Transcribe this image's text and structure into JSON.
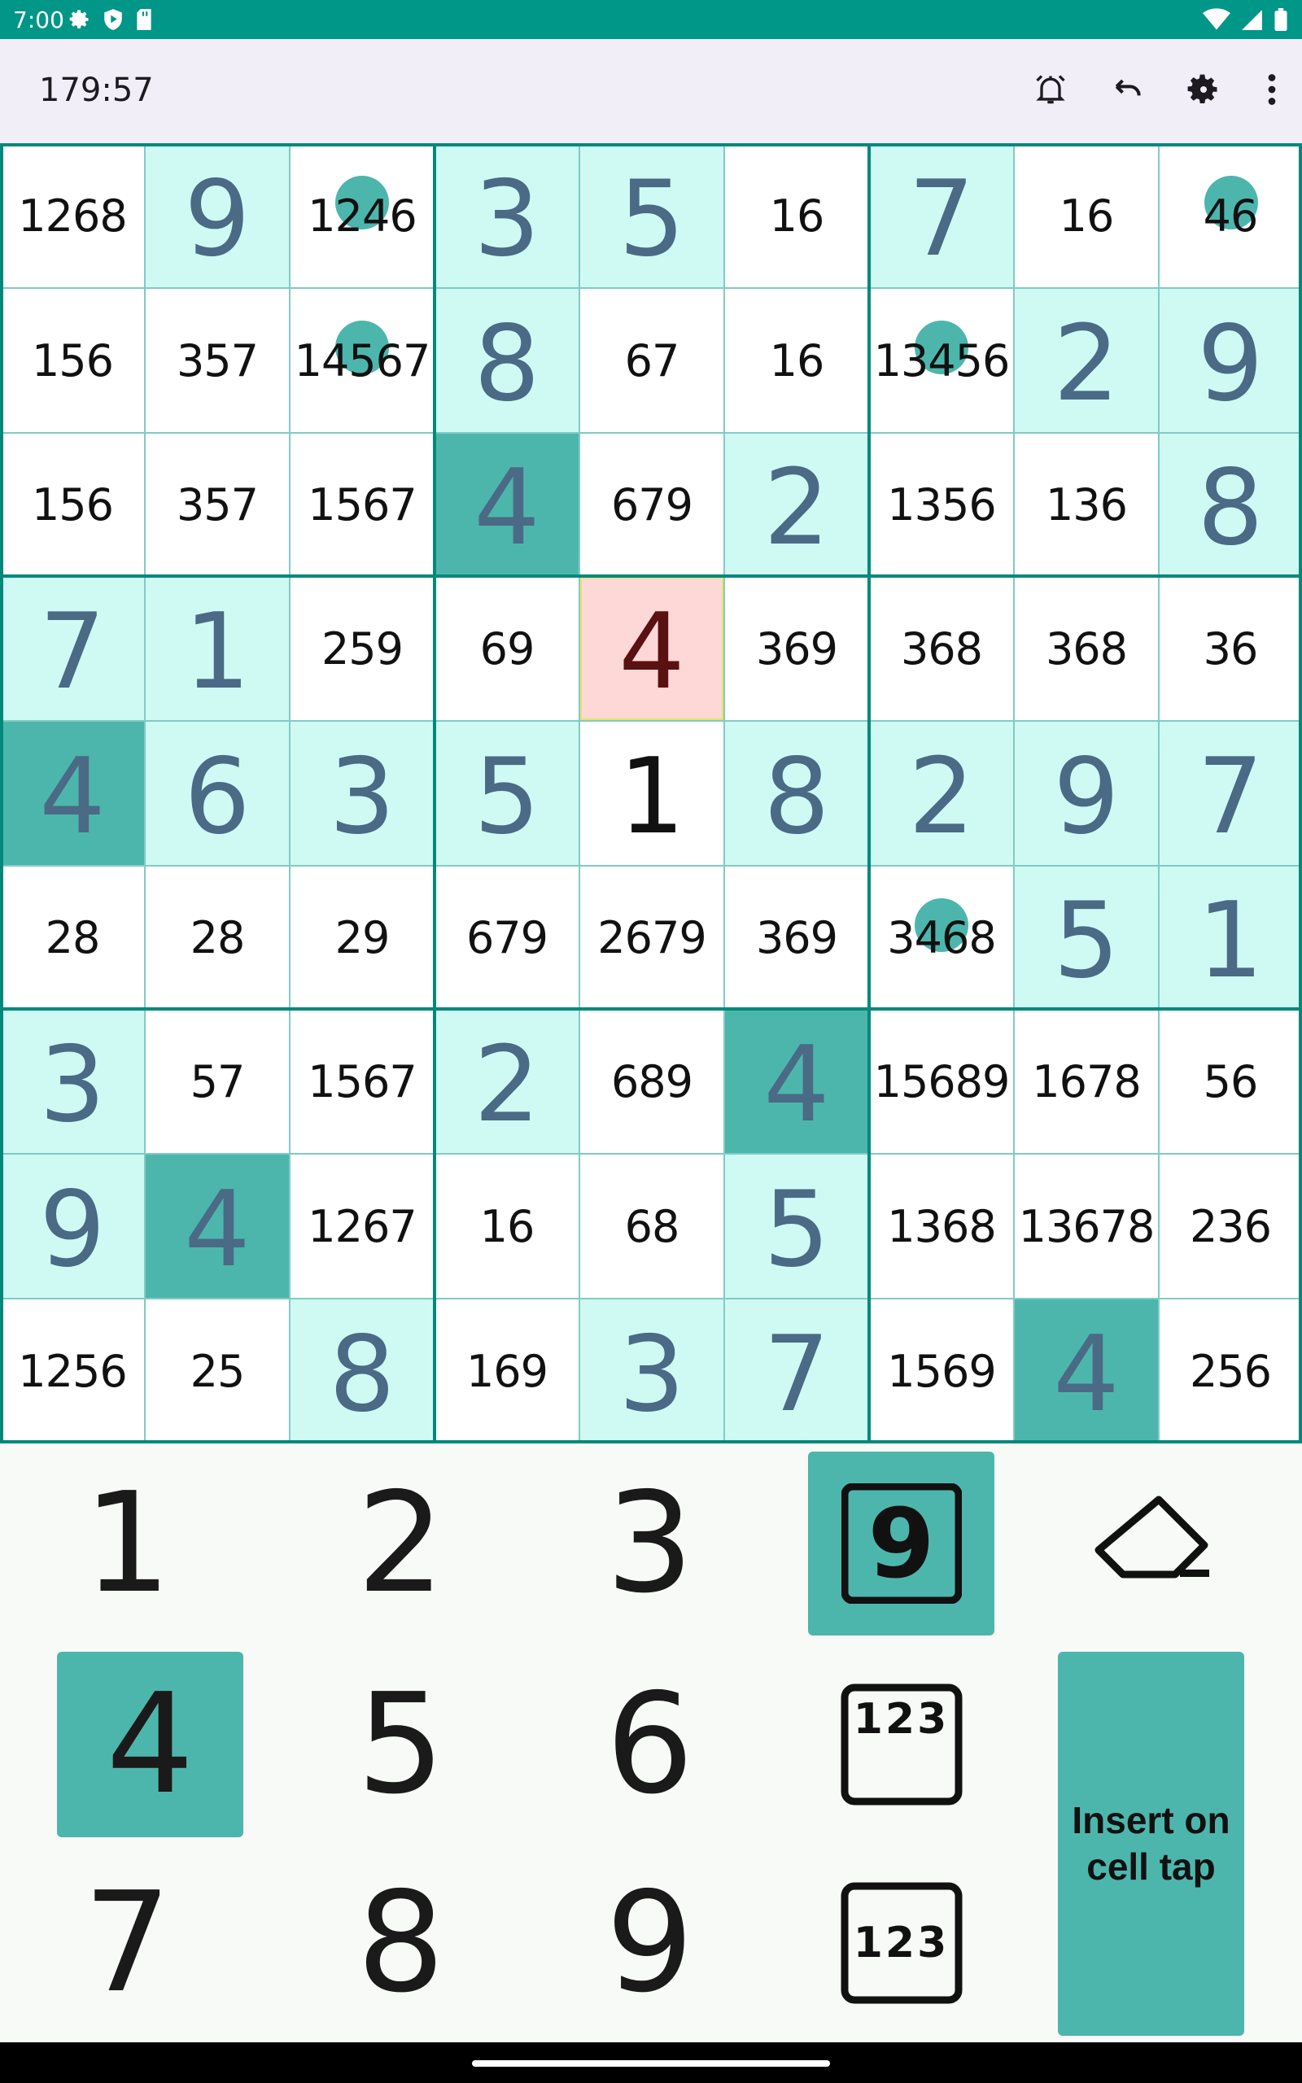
{
  "status_bar": {
    "time": "7:00",
    "left_icons": [
      "settings-icon",
      "shield-play-icon",
      "sd-card-icon"
    ],
    "right_icons": [
      "wifi-icon",
      "signal-icon",
      "battery-icon"
    ]
  },
  "app_bar": {
    "timer": "179:57",
    "actions": [
      "alarm-icon",
      "undo-icon",
      "settings-icon",
      "more-vert-icon"
    ]
  },
  "board": {
    "rows": [
      [
        {
          "v": "1268",
          "t": "c"
        },
        {
          "v": "9",
          "t": "g"
        },
        {
          "v": "1246",
          "t": "c",
          "dot": true
        },
        {
          "v": "3",
          "t": "g"
        },
        {
          "v": "5",
          "t": "g"
        },
        {
          "v": "16",
          "t": "c"
        },
        {
          "v": "7",
          "t": "g"
        },
        {
          "v": "16",
          "t": "c"
        },
        {
          "v": "46",
          "t": "c",
          "dot": true
        }
      ],
      [
        {
          "v": "156",
          "t": "c"
        },
        {
          "v": "357",
          "t": "c"
        },
        {
          "v": "14567",
          "t": "c",
          "dot": true
        },
        {
          "v": "8",
          "t": "g"
        },
        {
          "v": "67",
          "t": "c"
        },
        {
          "v": "16",
          "t": "c"
        },
        {
          "v": "13456",
          "t": "c",
          "dot": true
        },
        {
          "v": "2",
          "t": "g"
        },
        {
          "v": "9",
          "t": "g"
        }
      ],
      [
        {
          "v": "156",
          "t": "c"
        },
        {
          "v": "357",
          "t": "c"
        },
        {
          "v": "1567",
          "t": "c"
        },
        {
          "v": "4",
          "t": "g",
          "hl": "teal"
        },
        {
          "v": "679",
          "t": "c"
        },
        {
          "v": "2",
          "t": "g"
        },
        {
          "v": "1356",
          "t": "c"
        },
        {
          "v": "136",
          "t": "c"
        },
        {
          "v": "8",
          "t": "g"
        }
      ],
      [
        {
          "v": "7",
          "t": "g"
        },
        {
          "v": "1",
          "t": "g"
        },
        {
          "v": "259",
          "t": "c"
        },
        {
          "v": "69",
          "t": "c"
        },
        {
          "v": "4",
          "t": "e",
          "hl": "pink"
        },
        {
          "v": "369",
          "t": "c"
        },
        {
          "v": "368",
          "t": "c"
        },
        {
          "v": "368",
          "t": "c"
        },
        {
          "v": "36",
          "t": "c"
        }
      ],
      [
        {
          "v": "4",
          "t": "g",
          "hl": "teal"
        },
        {
          "v": "6",
          "t": "g"
        },
        {
          "v": "3",
          "t": "g"
        },
        {
          "v": "5",
          "t": "g"
        },
        {
          "v": "1",
          "t": "e"
        },
        {
          "v": "8",
          "t": "g"
        },
        {
          "v": "2",
          "t": "g"
        },
        {
          "v": "9",
          "t": "g"
        },
        {
          "v": "7",
          "t": "g"
        }
      ],
      [
        {
          "v": "28",
          "t": "c"
        },
        {
          "v": "28",
          "t": "c"
        },
        {
          "v": "29",
          "t": "c"
        },
        {
          "v": "679",
          "t": "c"
        },
        {
          "v": "2679",
          "t": "c"
        },
        {
          "v": "369",
          "t": "c"
        },
        {
          "v": "3468",
          "t": "c",
          "dot": true
        },
        {
          "v": "5",
          "t": "g"
        },
        {
          "v": "1",
          "t": "g"
        }
      ],
      [
        {
          "v": "3",
          "t": "g"
        },
        {
          "v": "57",
          "t": "c"
        },
        {
          "v": "1567",
          "t": "c"
        },
        {
          "v": "2",
          "t": "g"
        },
        {
          "v": "689",
          "t": "c"
        },
        {
          "v": "4",
          "t": "g",
          "hl": "teal"
        },
        {
          "v": "15689",
          "t": "c"
        },
        {
          "v": "1678",
          "t": "c"
        },
        {
          "v": "56",
          "t": "c"
        }
      ],
      [
        {
          "v": "9",
          "t": "g"
        },
        {
          "v": "4",
          "t": "g",
          "hl": "teal"
        },
        {
          "v": "1267",
          "t": "c"
        },
        {
          "v": "16",
          "t": "c"
        },
        {
          "v": "68",
          "t": "c"
        },
        {
          "v": "5",
          "t": "g"
        },
        {
          "v": "1368",
          "t": "c"
        },
        {
          "v": "13678",
          "t": "c"
        },
        {
          "v": "236",
          "t": "c"
        }
      ],
      [
        {
          "v": "1256",
          "t": "c"
        },
        {
          "v": "25",
          "t": "c"
        },
        {
          "v": "8",
          "t": "g"
        },
        {
          "v": "169",
          "t": "c"
        },
        {
          "v": "3",
          "t": "g"
        },
        {
          "v": "7",
          "t": "g"
        },
        {
          "v": "1569",
          "t": "c"
        },
        {
          "v": "4",
          "t": "g",
          "hl": "teal"
        },
        {
          "v": "256",
          "t": "c"
        }
      ]
    ]
  },
  "keypad": {
    "digits": [
      "1",
      "2",
      "3",
      "4",
      "5",
      "6",
      "7",
      "8",
      "9"
    ],
    "selected_digit": "4",
    "mode_buttons": [
      {
        "name": "value-mode",
        "label": "9",
        "selected": true
      },
      {
        "name": "corner-notes-mode",
        "label": "123",
        "selected": false
      },
      {
        "name": "center-notes-mode",
        "label": "123",
        "selected": false
      }
    ],
    "eraser_icon": "eraser-icon",
    "insert_label_line1": "Insert on",
    "insert_label_line2": "cell tap"
  },
  "colors": {
    "status_bar": "#009688",
    "app_bar": "#f1eef7",
    "given_bg": "#cffaf4",
    "highlight_teal": "#4db6ac",
    "selected_cell": "#fdd8d6",
    "selected_border": "#e6e36a",
    "given_text": "#4a6a85",
    "box_line": "#00897b",
    "grid_line": "#80cbc4"
  }
}
